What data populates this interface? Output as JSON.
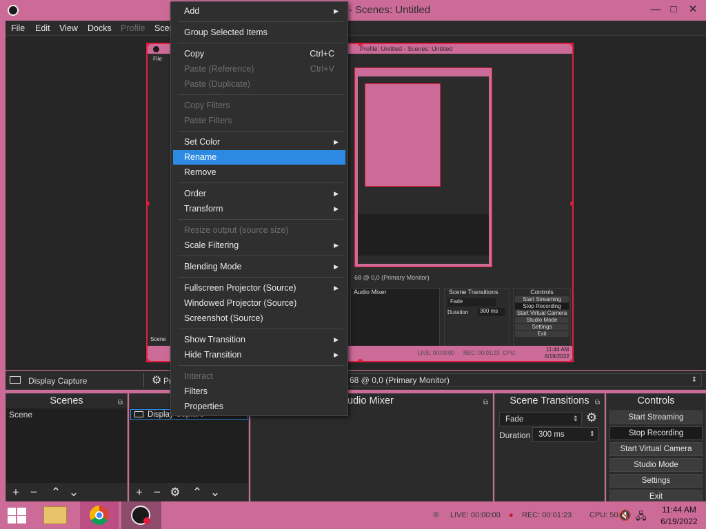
{
  "window": {
    "title": "Profile: Untitled - Scenes: Untitled"
  },
  "menubar": {
    "file": "File",
    "edit": "Edit",
    "view": "View",
    "docks": "Docks",
    "profile": "Profile",
    "scene": "Scer"
  },
  "preview_inner": {
    "title": "Profile: Untitled - Scenes: Untitled",
    "menu_file": "File",
    "source_line": "68 @ 0,0 (Primary Monitor)",
    "audio_mixer": "Audio Mixer",
    "scene_transitions": "Scene Transitions",
    "controls": "Controls",
    "fade": "Fade",
    "duration_label": "Duration",
    "duration_value": "300 ms",
    "start_streaming": "Start Streaming",
    "stop_recording": "Stop Recording",
    "start_virtual_camera": "Start Virtual Camera",
    "studio_mode": "Studio Mode",
    "settings": "Settings",
    "exit": "Exit",
    "scene_label": "Scene",
    "live": "LIVE: 00:00:00",
    "rec": "REC: 00:01:23",
    "cpu": "CPU:",
    "time": "11:44 AM",
    "date": "6/19/2022"
  },
  "context_menu": {
    "items": [
      {
        "label": "Add",
        "submenu": true,
        "disabled": false
      },
      {
        "label": "Group Selected Items",
        "disabled": false
      },
      {
        "label": "Copy",
        "shortcut": "Ctrl+C",
        "disabled": false
      },
      {
        "label": "Paste (Reference)",
        "shortcut": "Ctrl+V",
        "disabled": true
      },
      {
        "label": "Paste (Duplicate)",
        "disabled": true
      },
      {
        "label": "Copy Filters",
        "disabled": true
      },
      {
        "label": "Paste Filters",
        "disabled": true
      },
      {
        "label": "Set Color",
        "submenu": true,
        "disabled": false
      },
      {
        "label": "Rename",
        "disabled": false,
        "selected": true
      },
      {
        "label": "Remove",
        "disabled": false
      },
      {
        "label": "Order",
        "submenu": true,
        "disabled": false
      },
      {
        "label": "Transform",
        "submenu": true,
        "disabled": false
      },
      {
        "label": "Resize output (source size)",
        "disabled": true
      },
      {
        "label": "Scale Filtering",
        "submenu": true,
        "disabled": false
      },
      {
        "label": "Blending Mode",
        "submenu": true,
        "disabled": false
      },
      {
        "label": "Fullscreen Projector (Source)",
        "submenu": true,
        "disabled": false
      },
      {
        "label": "Windowed Projector (Source)",
        "disabled": false
      },
      {
        "label": "Screenshot (Source)",
        "disabled": false
      },
      {
        "label": "Show Transition",
        "submenu": true,
        "disabled": false
      },
      {
        "label": "Hide Transition",
        "submenu": true,
        "disabled": false
      },
      {
        "label": "Interact",
        "disabled": true
      },
      {
        "label": "Filters",
        "disabled": false
      },
      {
        "label": "Properties",
        "disabled": false
      }
    ]
  },
  "source_bar": {
    "source_name": "Display Capture",
    "props_prefix": "Pr",
    "monitor": "68 @ 0,0 (Primary Monitor)"
  },
  "scenes": {
    "title": "Scenes",
    "items": [
      "Scene"
    ]
  },
  "sources": {
    "title": "S",
    "items": [
      "Display Capture"
    ]
  },
  "audio_mixer": {
    "title": "udio Mixer"
  },
  "scene_transitions": {
    "title": "Scene Transitions",
    "transition": "Fade",
    "duration_label": "Duration",
    "duration_value": "300 ms"
  },
  "controls": {
    "title": "Controls",
    "start_streaming": "Start Streaming",
    "stop_recording": "Stop Recording",
    "start_virtual_camera": "Start Virtual Camera",
    "studio_mode": "Studio Mode",
    "settings": "Settings",
    "exit": "Exit"
  },
  "status": {
    "live": "LIVE: 00:00:00",
    "rec": "REC: 00:01:23",
    "cpu": "CPU: 50."
  },
  "taskbar": {
    "time": "11:44 AM",
    "date": "6/19/2022"
  },
  "colors": {
    "accent": "#2d8ae3",
    "selection_border": "#e01e3c",
    "desktop": "#cc6b98"
  }
}
